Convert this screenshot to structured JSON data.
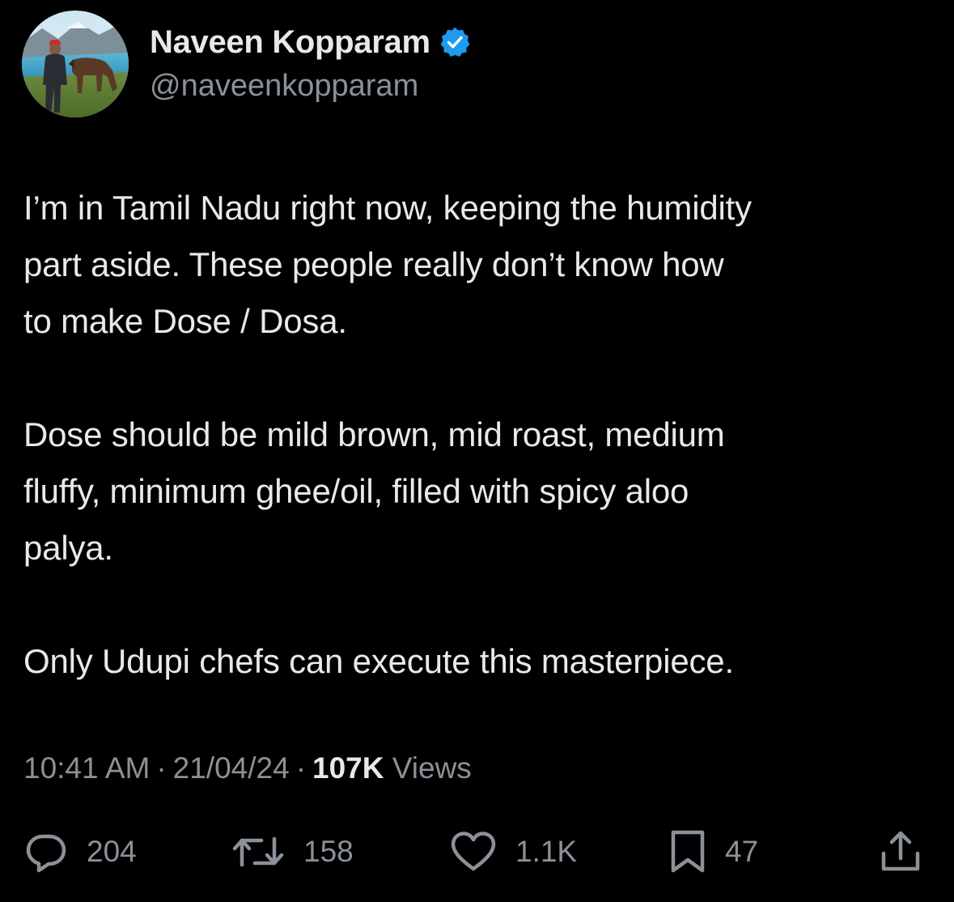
{
  "author": {
    "display_name": "Naveen Kopparam",
    "handle": "@naveenkopparam",
    "verified": true,
    "avatar": "avatar-photo-man-with-horse",
    "verified_icon": "verified-badge-icon"
  },
  "tweet": {
    "paragraphs": [
      "I’m in Tamil Nadu right now, keeping the humidity\npart aside. These people really don’t know how\nto make Dose / Dosa.",
      "Dose should be mild brown, mid roast, medium\nfluffy, minimum ghee/oil, filled with spicy aloo\npalya.",
      "Only Udupi chefs can execute this masterpiece."
    ]
  },
  "meta": {
    "time": "10:41 AM",
    "separator": "·",
    "date": "21/04/24",
    "views_count": "107K",
    "views_label": "Views"
  },
  "actions": {
    "replies": "204",
    "retweets": "158",
    "likes": "1.1K",
    "bookmarks": "47",
    "icons": [
      "reply-icon",
      "retweet-icon",
      "like-icon",
      "bookmark-icon",
      "share-icon"
    ]
  },
  "colors": {
    "background": "#000000",
    "text_primary": "#e7e9ea",
    "text_secondary": "#8b9198",
    "verified_blue": "#1d9bf0"
  }
}
